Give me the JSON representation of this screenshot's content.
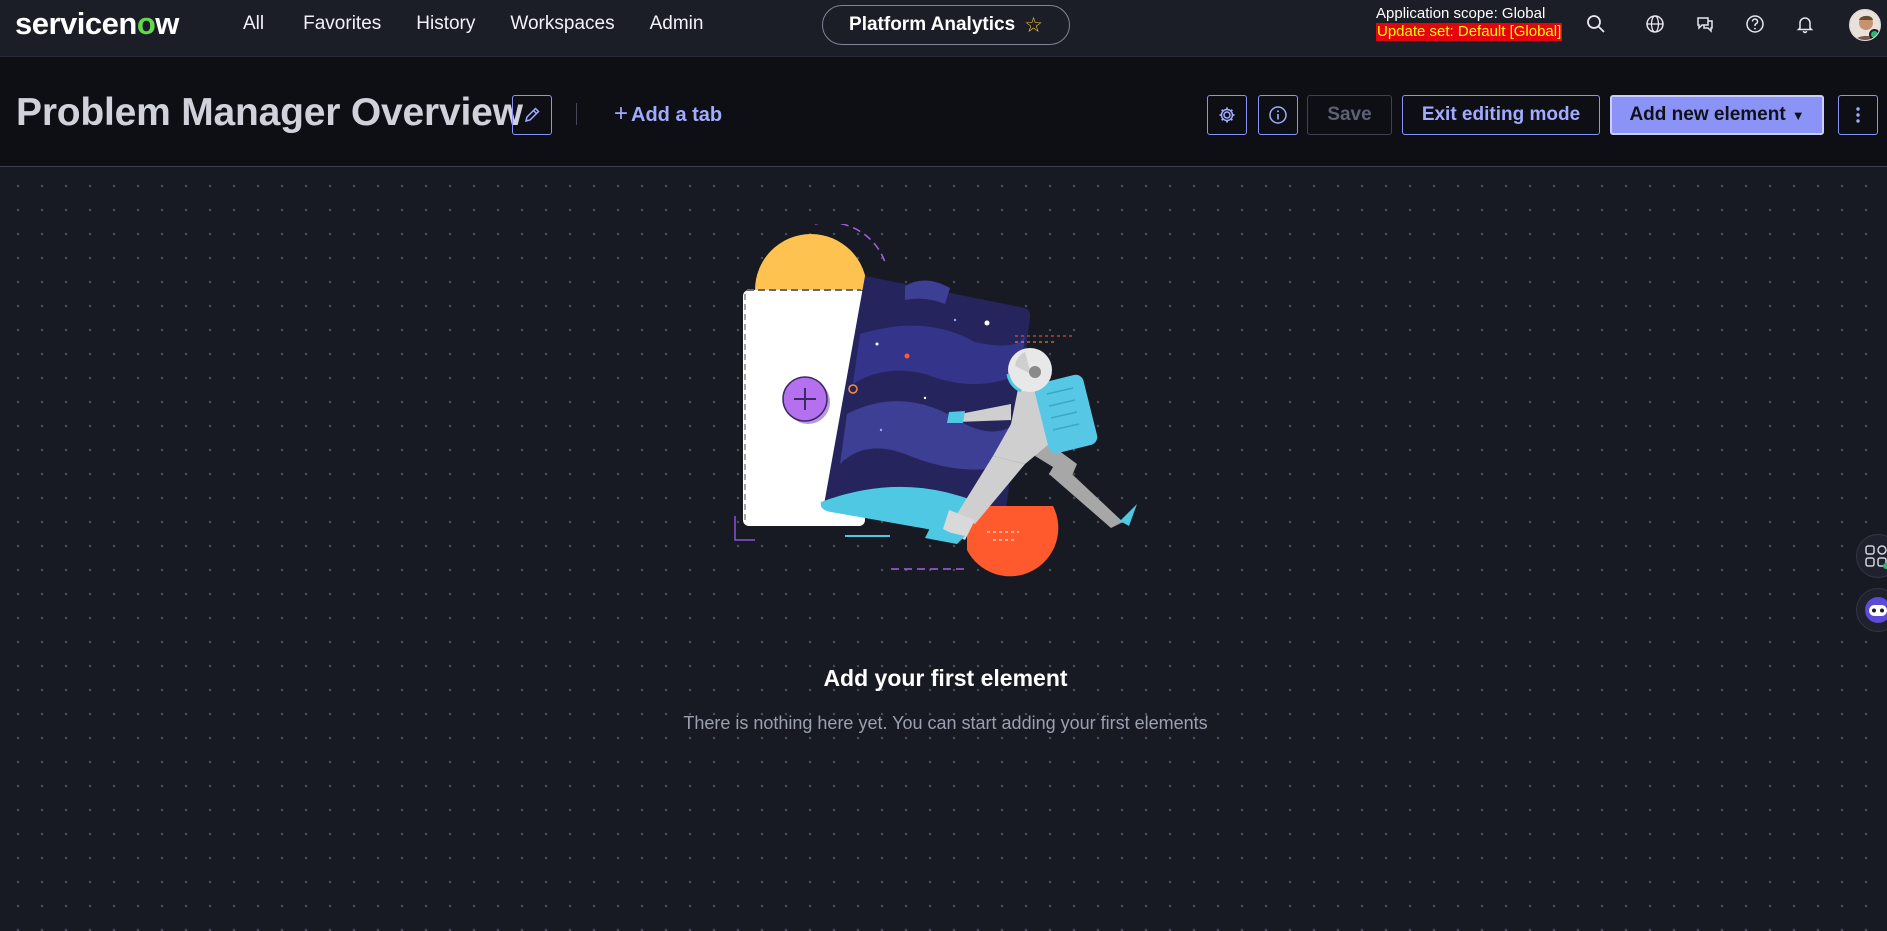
{
  "topnav": {
    "logo_prefix": "servicen",
    "logo_o": "o",
    "logo_suffix": "w",
    "links": [
      "All",
      "Favorites",
      "History",
      "Workspaces",
      "Admin"
    ],
    "workspace_pill": "Platform Analytics",
    "scope_label": "Application scope: Global",
    "update_set_label": "Update set: Default [Global]",
    "icons": [
      "search-icon",
      "globe-icon",
      "chat-icon",
      "help-icon",
      "bell-icon"
    ]
  },
  "header": {
    "title": "Problem Manager Overview",
    "add_tab_label": "Add a tab",
    "save_label": "Save",
    "exit_label": "Exit editing mode",
    "add_element_label": "Add new element"
  },
  "empty_state": {
    "title": "Add your first element",
    "subtitle": "There is nothing here yet. You can start adding your first elements"
  },
  "colors": {
    "accent": "#8b93f7",
    "accent_text": "#a2abff",
    "update_set_bg": "#e3040f",
    "update_set_text": "#ffff00",
    "logo_green": "#62d84e"
  }
}
